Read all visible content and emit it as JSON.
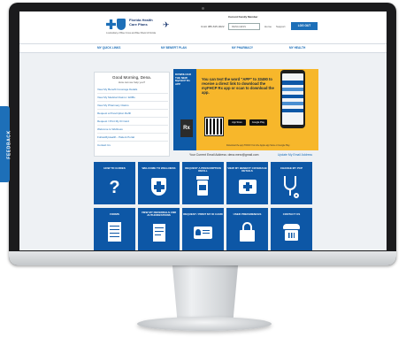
{
  "header": {
    "logo_text": "Florida Health Care Plans",
    "logo_tagline": "A subsidiary of Blue Cross and Blue Shield of Florida",
    "family_member_label": "Current Family Member",
    "phone_text": "Cntct 386-615-4022",
    "member_select": "DENA HESS",
    "home_label": "Home",
    "support_label": "Support",
    "logout_label": "LOG OUT"
  },
  "nav": {
    "items": [
      "MY QUICK LINKS",
      "MY BENEFIT PLAN",
      "MY PHARMACY",
      "MY HEALTH"
    ]
  },
  "greeting": {
    "title": "Good Morning, Dena.",
    "subtitle": "How can we help you?",
    "links": [
      "View My Benefit Coverage Details",
      "View My Medical Claims / EOBs",
      "View My Pharmacy Claims",
      "Request a Prescription Refill",
      "Request / Print My ID Card",
      "Welcome to Wellness",
      "FollowMyHealth - Patient Portal",
      "Contact Us"
    ]
  },
  "banner": {
    "side_text": "DOWNLOAD THE NEW MyFHCP Rx APP",
    "headline": "You can text the word \"APP\" to 33490 to receive a direct link to download the myFHCP Rx app or scan to download the app.",
    "rx_logo": "Rx",
    "app_store": "App Store",
    "google_play": "Google Play",
    "footer": "Download the app TODAY from the Apple app Store or Google Play."
  },
  "email": {
    "current": "Your Current Email Address: dena.merz@gmail.com",
    "update_link": "Update My Email Address"
  },
  "tiles": [
    {
      "label": "HOW TO GUIDES",
      "icon": "question-icon"
    },
    {
      "label": "WELCOME TO WELLNESS",
      "icon": "shield-plus-icon"
    },
    {
      "label": "REQUEST A PRESCRIPTION REFILL",
      "icon": "pill-bottle-icon"
    },
    {
      "label": "VIEW MY BENEFIT COVERAGE DETAILS",
      "icon": "medical-kit-icon"
    },
    {
      "label": "CHANGE MY PCP",
      "icon": "stethoscope-icon"
    },
    {
      "label": "FORMS",
      "icon": "form-icon"
    },
    {
      "label": "VIEW MY REFERRALS AND AUTHORIZATIONS",
      "icon": "document-icon"
    },
    {
      "label": "REQUEST / PRINT MY ID CARD",
      "icon": "id-card-icon"
    },
    {
      "label": "USER PREFERENCES",
      "icon": "lock-icon"
    },
    {
      "label": "CONTACT US",
      "icon": "phone-icon"
    }
  ],
  "feedback_label": "FEEDBACK"
}
